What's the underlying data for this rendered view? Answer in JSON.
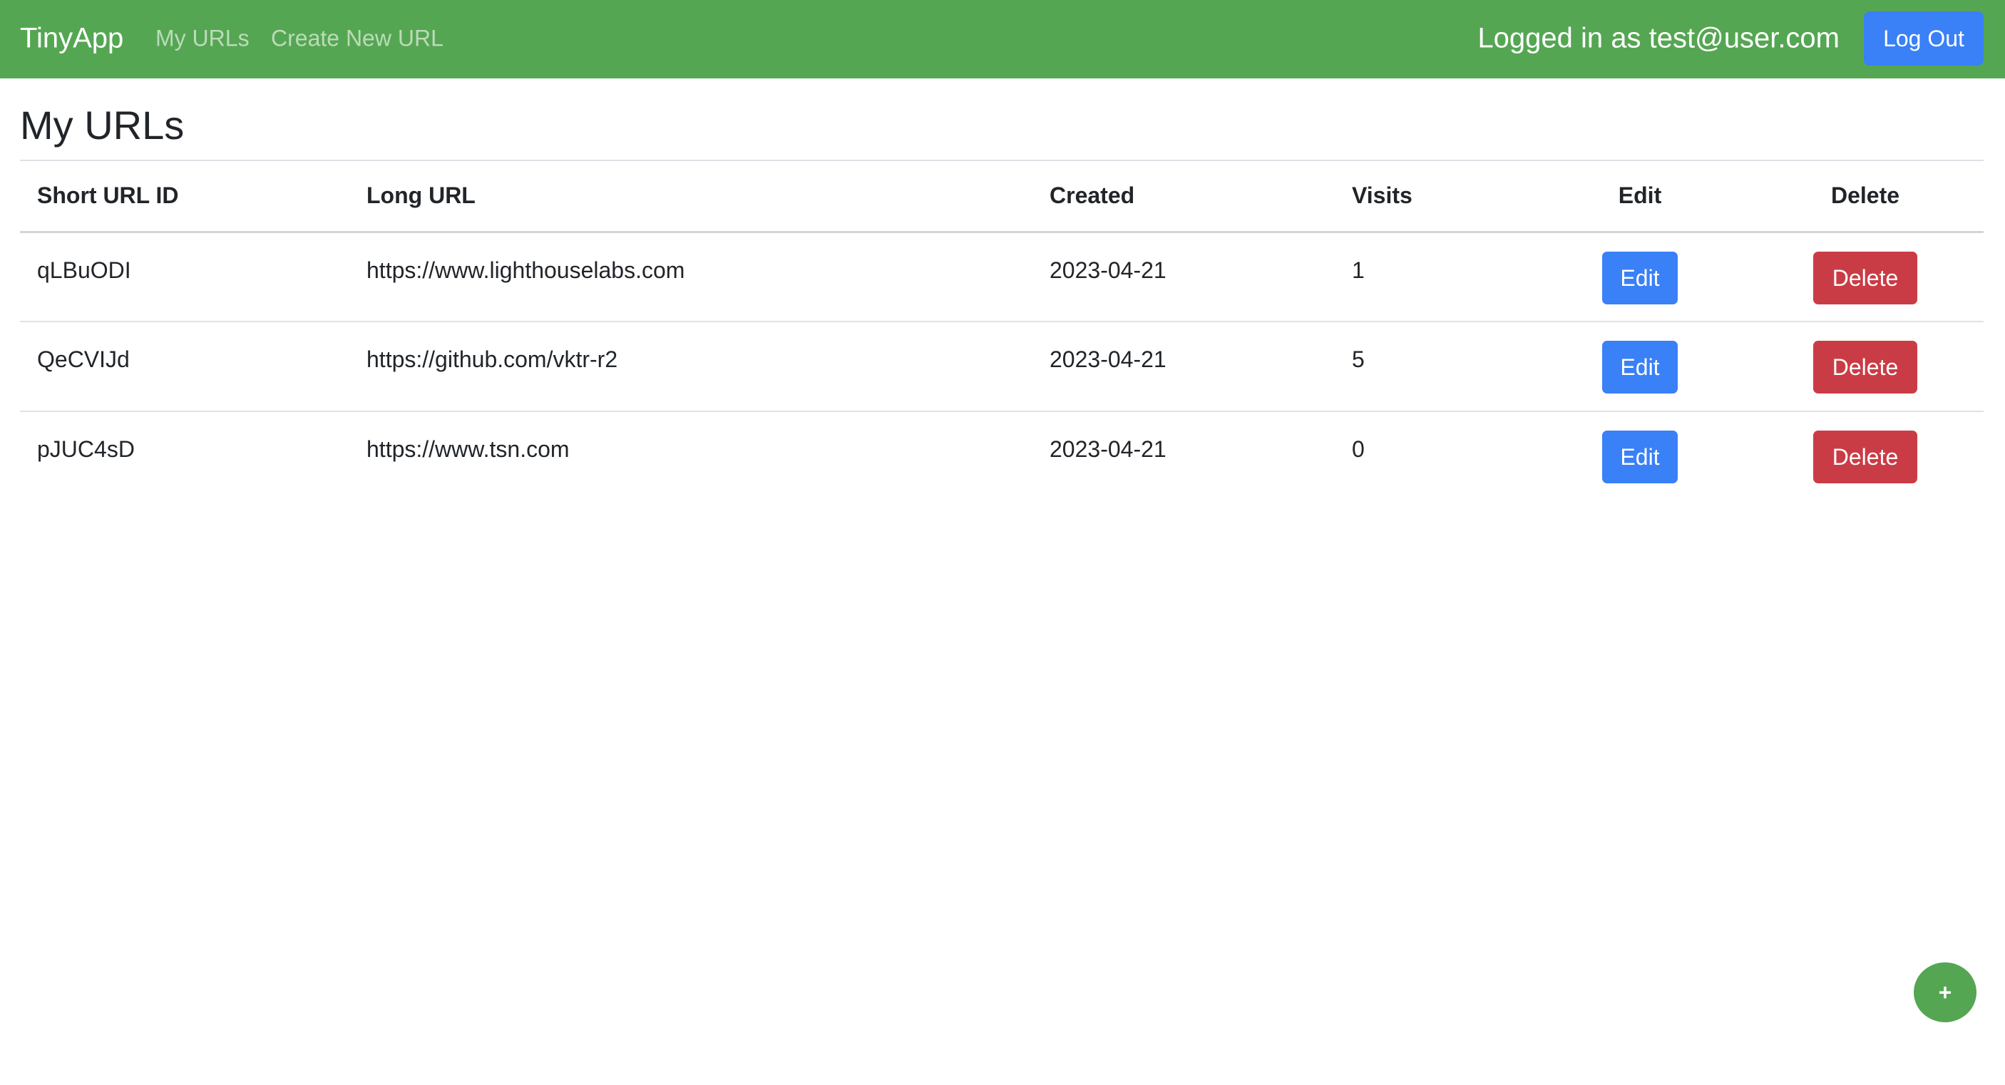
{
  "navbar": {
    "brand": "TinyApp",
    "links": [
      {
        "label": "My URLs"
      },
      {
        "label": "Create New URL"
      }
    ],
    "logged_in_text": "Logged in as test@user.com",
    "logout_label": "Log Out",
    "background_color": "#55a652"
  },
  "page": {
    "title": "My URLs"
  },
  "table": {
    "headers": {
      "short_id": "Short URL ID",
      "long_url": "Long URL",
      "created": "Created",
      "visits": "Visits",
      "edit": "Edit",
      "delete": "Delete"
    },
    "rows": [
      {
        "short_id": "qLBuODI",
        "long_url": "https://www.lighthouselabs.com",
        "created": "2023-04-21",
        "visits": "1",
        "edit_label": "Edit",
        "delete_label": "Delete"
      },
      {
        "short_id": "QeCVIJd",
        "long_url": "https://github.com/vktr-r2",
        "created": "2023-04-21",
        "visits": "5",
        "edit_label": "Edit",
        "delete_label": "Delete"
      },
      {
        "short_id": "pJUC4sD",
        "long_url": "https://www.tsn.com",
        "created": "2023-04-21",
        "visits": "0",
        "edit_label": "Edit",
        "delete_label": "Delete"
      }
    ]
  },
  "fab": {
    "label": "+",
    "icon": "plus-icon"
  },
  "colors": {
    "primary": "#3a80f6",
    "danger": "#ca3c45",
    "success": "#55a652"
  }
}
